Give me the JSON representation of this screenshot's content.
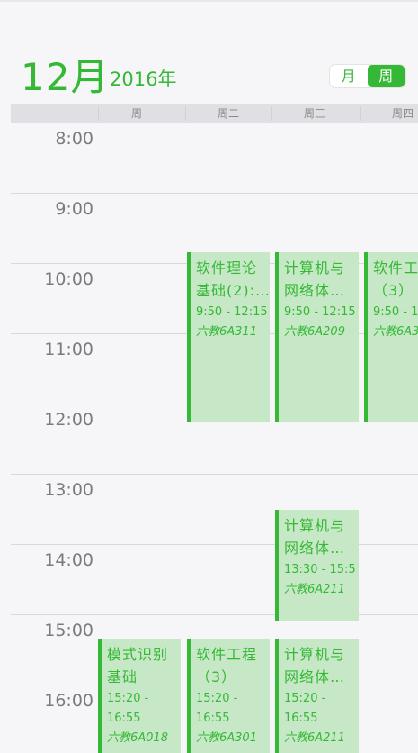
{
  "header": {
    "month": "12月",
    "year": "2016年",
    "view_month": "月",
    "view_week": "周"
  },
  "weekdays": [
    "周一",
    "周二",
    "周三",
    "周四"
  ],
  "hours": [
    "8:00",
    "9:00",
    "10:00",
    "11:00",
    "12:00",
    "13:00",
    "14:00",
    "15:00",
    "16:00"
  ],
  "events": [
    {
      "title_line1": "软件理论",
      "title_line2": "基础(2):…",
      "time": "9:50 - 12:15",
      "room": "六教6A311"
    },
    {
      "title_line1": "计算机与",
      "title_line2": "网络体…",
      "time": "9:50 - 12:15",
      "room": "六教6A209"
    },
    {
      "title_line1": "软件工",
      "title_line2": "（3）",
      "time": "9:50 - 1",
      "room": "六教6A3"
    },
    {
      "title_line1": "计算机与",
      "title_line2": "网络体…",
      "time": "13:30 - 15:5",
      "room": "六教6A211"
    },
    {
      "title_line1": "模式识别",
      "title_line2": "基础",
      "time_line1": "15:20 -",
      "time_line2": "16:55",
      "room": "六教6A018"
    },
    {
      "title_line1": "软件工程",
      "title_line2": "（3）",
      "time_line1": "15:20 -",
      "time_line2": "16:55",
      "room": "六教6A301"
    },
    {
      "title_line1": "计算机与",
      "title_line2": "网络体…",
      "time_line1": "15:20 -",
      "time_line2": "16:55",
      "room": "六教6A211"
    }
  ],
  "colors": {
    "accent": "#35b835",
    "event_fill": "#c6e8c6",
    "background": "#f6f6f8"
  }
}
